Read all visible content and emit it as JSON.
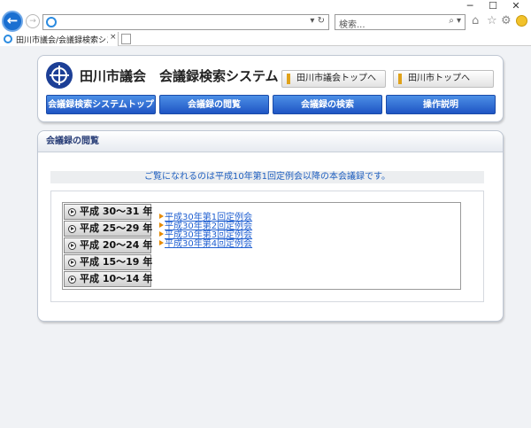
{
  "browser": {
    "address_value": "",
    "search_placeholder": "検索...",
    "tab_title": "田川市議会/会議録検索シス...",
    "tab_close": "×",
    "addr_tools": "▾ ↻",
    "search_tools": "⌕ ▾",
    "window_controls": [
      "─",
      "☐",
      "✕"
    ]
  },
  "header": {
    "site_title": "田川市議会　会議録検索システム",
    "links": [
      {
        "label": "田川市議会トップへ"
      },
      {
        "label": "田川市トップへ"
      }
    ],
    "menu": [
      {
        "label": "会議録検索システムトップ"
      },
      {
        "label": "会議録の閲覧"
      },
      {
        "label": "会議録の検索"
      },
      {
        "label": "操作説明"
      }
    ]
  },
  "main": {
    "section_title": "会議録の閲覧",
    "notice": "ご覧になれるのは平成10年第1回定例会以降の本会議録です。",
    "year_ranges": [
      {
        "label": "平成 30～31 年"
      },
      {
        "label": "平成 25～29 年"
      },
      {
        "label": "平成 20～24 年"
      },
      {
        "label": "平成 15～19 年"
      },
      {
        "label": "平成 10～14 年"
      }
    ],
    "sessions": [
      {
        "label": "平成30年第1回定例会"
      },
      {
        "label": "平成30年第2回定例会"
      },
      {
        "label": "平成30年第3回定例会"
      },
      {
        "label": "平成30年第4回定例会"
      }
    ]
  },
  "colors": {
    "menu_blue": "#1f55c4",
    "link_blue": "#1f5fd1",
    "accent_orange": "#e68a00",
    "title_navy": "#2a3f78"
  }
}
